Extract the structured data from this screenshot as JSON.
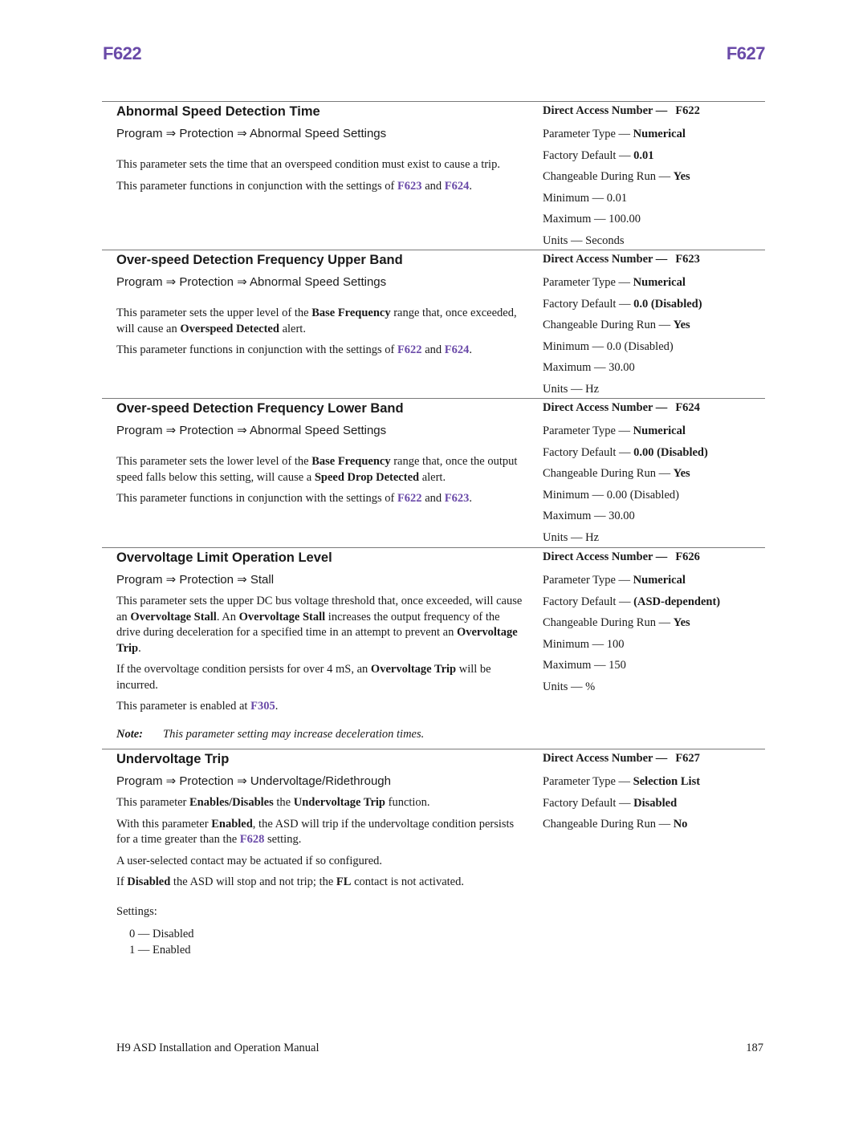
{
  "header": {
    "left": "F622",
    "right": "F627"
  },
  "colors": {
    "accent": "#6a4aa8",
    "text": "#1a1a1a",
    "rule": "#7a7a7a"
  },
  "sections": [
    {
      "title": "Abnormal Speed Detection Time",
      "path": "Program ⇒ Protection ⇒ Abnormal Speed Settings",
      "p1": "This parameter sets the time that an overspeed condition must exist to cause a trip.",
      "p2_pre": "This parameter functions in conjunction with the settings of ",
      "p2_link1": "F623",
      "p2_mid": " and ",
      "p2_link2": "F624",
      "p2_post": ".",
      "props": {
        "dan_label": "Direct Access Number —",
        "dan_value": "F622",
        "type_label": "Parameter Type — ",
        "type_value": "Numerical",
        "default_label": "Factory Default — ",
        "default_value": "0.01",
        "run_label": "Changeable During Run — ",
        "run_value": "Yes",
        "min": "Minimum — 0.01",
        "max": "Maximum — 100.00",
        "units": "Units — Seconds"
      }
    },
    {
      "title": "Over-speed Detection Frequency Upper Band",
      "path": "Program ⇒ Protection ⇒ Abnormal Speed Settings",
      "p1_pre": "This parameter sets the upper level of the ",
      "p1_b1": "Base Frequency",
      "p1_mid": " range that, once exceeded, will cause an ",
      "p1_b2": "Overspeed Detected",
      "p1_post": " alert.",
      "p2_pre": "This parameter functions in conjunction with the settings of ",
      "p2_link1": "F622",
      "p2_mid": " and ",
      "p2_link2": "F624",
      "p2_post": ".",
      "props": {
        "dan_label": "Direct Access Number —",
        "dan_value": "F623",
        "type_label": "Parameter Type — ",
        "type_value": "Numerical",
        "default_label": "Factory Default — ",
        "default_value": "0.0 (Disabled)",
        "run_label": "Changeable During Run — ",
        "run_value": "Yes",
        "min": "Minimum — 0.0 (Disabled)",
        "max": "Maximum — 30.00",
        "units": "Units — Hz"
      }
    },
    {
      "title": "Over-speed Detection Frequency Lower Band",
      "path": "Program ⇒ Protection ⇒ Abnormal Speed Settings",
      "p1_pre": "This parameter sets the lower level of the ",
      "p1_b1": "Base Frequency",
      "p1_mid": " range that, once the output speed falls below this setting, will cause a ",
      "p1_b2": "Speed Drop Detected",
      "p1_post": " alert.",
      "p2_pre": "This parameter functions in conjunction with the settings of ",
      "p2_link1": "F622",
      "p2_mid": " and ",
      "p2_link2": "F623",
      "p2_post": ".",
      "props": {
        "dan_label": "Direct Access Number —",
        "dan_value": "F624",
        "type_label": "Parameter Type — ",
        "type_value": "Numerical",
        "default_label": "Factory Default — ",
        "default_value": "0.00 (Disabled)",
        "run_label": "Changeable During Run — ",
        "run_value": "Yes",
        "min": "Minimum — 0.00 (Disabled)",
        "max": "Maximum — 30.00",
        "units": "Units — Hz"
      }
    },
    {
      "title": "Overvoltage Limit Operation Level",
      "path": "Program ⇒ Protection ⇒ Stall",
      "p1_a": "This parameter sets the upper DC bus voltage threshold that, once exceeded, will cause an ",
      "p1_b1": "Overvoltage Stall",
      "p1_c": ". An ",
      "p1_b2": "Overvoltage Stall",
      "p1_d": " increases the output frequency of the drive during deceleration for a specified time in an attempt to prevent an ",
      "p1_b3": "Overvoltage Trip",
      "p1_e": ".",
      "p2_pre": "If the overvoltage condition persists for over 4 mS, an ",
      "p2_b": "Overvoltage Trip",
      "p2_post": " will be incurred.",
      "p3_pre": "This parameter is enabled at ",
      "p3_link": "F305",
      "p3_post": ".",
      "note_label": "Note:",
      "note_text": "This parameter setting may increase deceleration times.",
      "props": {
        "dan_label": "Direct Access Number —",
        "dan_value": "F626",
        "type_label": "Parameter Type — ",
        "type_value": "Numerical",
        "default_label": "Factory Default — ",
        "default_value": "(ASD-dependent)",
        "run_label": "Changeable During Run — ",
        "run_value": "Yes",
        "min": "Minimum — 100",
        "max": "Maximum — 150",
        "units": "Units — %"
      }
    },
    {
      "title": "Undervoltage Trip",
      "path": "Program ⇒ Protection ⇒ Undervoltage/Ridethrough",
      "p1_pre": "This parameter ",
      "p1_b1": "Enables/Disables",
      "p1_mid": " the ",
      "p1_b2": "Undervoltage Trip",
      "p1_post": " function.",
      "p2_pre": "With this parameter ",
      "p2_b": "Enabled",
      "p2_mid": ", the ASD will trip if the undervoltage condition persists for a time greater than the ",
      "p2_link": "F628",
      "p2_post": " setting.",
      "p3": "A user-selected contact may be actuated if so configured.",
      "p4_pre": "If ",
      "p4_b1": "Disabled",
      "p4_mid": " the ASD will stop and not trip; the ",
      "p4_b2": "FL",
      "p4_post": " contact is not activated.",
      "settings_label": "Settings:",
      "settings": [
        "0 — Disabled",
        "1 — Enabled"
      ],
      "props": {
        "dan_label": "Direct Access Number —",
        "dan_value": "F627",
        "type_label": "Parameter Type — ",
        "type_value": "Selection List",
        "default_label": "Factory Default — ",
        "default_value": "Disabled",
        "run_label": "Changeable During Run — ",
        "run_value": "No"
      }
    }
  ],
  "footer": {
    "left": "H9 ASD Installation and Operation Manual",
    "right": "187"
  }
}
